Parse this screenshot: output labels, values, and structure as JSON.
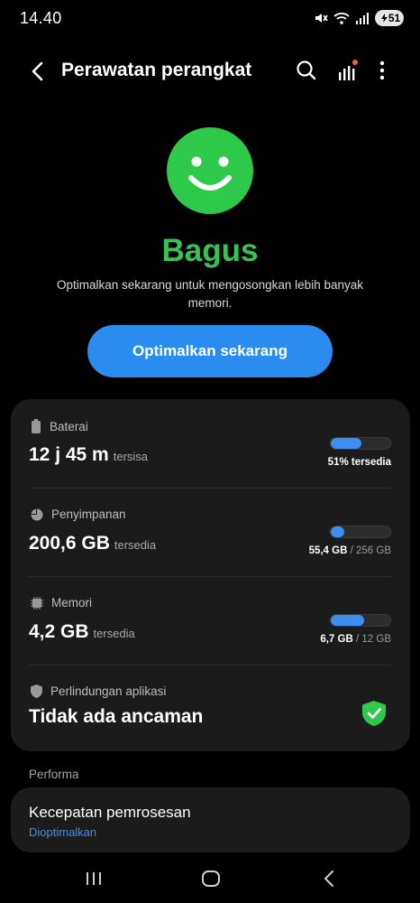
{
  "status_bar": {
    "time": "14.40",
    "battery_level": "51",
    "icons": [
      "mute-icon",
      "wifi-icon",
      "signal-icon",
      "battery-icon"
    ]
  },
  "app_bar": {
    "title": "Perawatan perangkat",
    "actions": [
      "back-icon",
      "search-icon",
      "chart-icon",
      "more-vertical-icon"
    ]
  },
  "hero": {
    "icon": "smiley-icon",
    "status": "Bagus",
    "description": "Optimalkan sekarang untuk mengosongkan lebih banyak memori.",
    "button_label": "Optimalkan sekarang"
  },
  "stats": {
    "battery": {
      "label": "Baterai",
      "value": "12 j 45 m",
      "suffix": "tersisa",
      "percent": 51,
      "right_text": "51% tersedia"
    },
    "storage": {
      "label": "Penyimpanan",
      "value": "200,6 GB",
      "suffix": "tersedia",
      "used": "55,4 GB",
      "separator": "/",
      "total": "256 GB",
      "fill_fraction": 0.22
    },
    "memory": {
      "label": "Memori",
      "value": "4,2 GB",
      "suffix": "tersedia",
      "used": "6,7 GB",
      "separator": "/",
      "total": "12 GB",
      "fill_fraction": 0.56
    },
    "protection": {
      "label": "Perlindungan aplikasi",
      "value": "Tidak ada ancaman"
    }
  },
  "performance": {
    "section_label": "Performa",
    "title": "Kecepatan pemrosesan",
    "subtitle": "Dioptimalkan"
  },
  "colors": {
    "accent": "#2b8cf0",
    "good": "#36c353",
    "card": "#1b1b1b"
  }
}
